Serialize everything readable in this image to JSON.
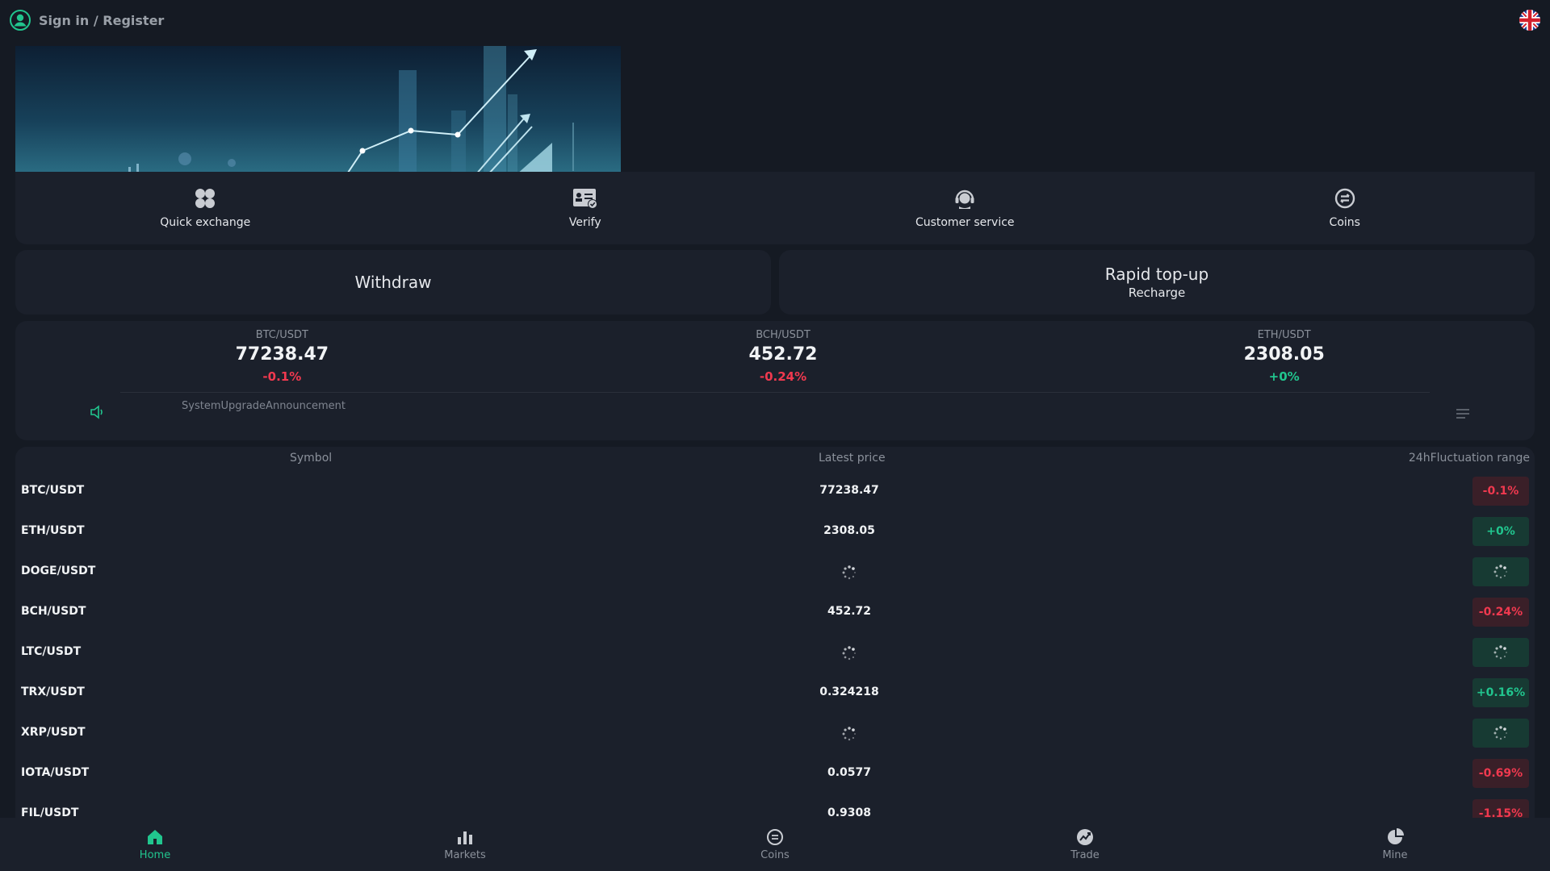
{
  "header": {
    "signin_label": "Sign in / Register",
    "language_flag": "uk-flag-icon"
  },
  "quick_actions": [
    {
      "label": "Quick exchange",
      "icon": "grid-icon"
    },
    {
      "label": "Verify",
      "icon": "id-card-icon"
    },
    {
      "label": "Customer service",
      "icon": "headset-icon"
    },
    {
      "label": "Coins",
      "icon": "coin-icon"
    }
  ],
  "cards": {
    "withdraw": "Withdraw",
    "rapid_topup": "Rapid top-up",
    "recharge": "Recharge"
  },
  "ticker": [
    {
      "pair": "BTC/USDT",
      "price": "77238.47",
      "change": "-0.1%",
      "trend": "down"
    },
    {
      "pair": "BCH/USDT",
      "price": "452.72",
      "change": "-0.24%",
      "trend": "down"
    },
    {
      "pair": "ETH/USDT",
      "price": "2308.05",
      "change": "+0%",
      "trend": "up"
    }
  ],
  "announcement": "SystemUpgradeAnnouncement",
  "market": {
    "headers": {
      "symbol": "Symbol",
      "latest_price": "Latest price",
      "range": "24hFluctuation range"
    },
    "rows": [
      {
        "symbol": "BTC/USDT",
        "price": "77238.47",
        "change": "-0.1%",
        "trend": "down"
      },
      {
        "symbol": "ETH/USDT",
        "price": "2308.05",
        "change": "+0%",
        "trend": "up"
      },
      {
        "symbol": "DOGE/USDT",
        "price": "",
        "change": "",
        "trend": "loading"
      },
      {
        "symbol": "BCH/USDT",
        "price": "452.72",
        "change": "-0.24%",
        "trend": "down"
      },
      {
        "symbol": "LTC/USDT",
        "price": "",
        "change": "",
        "trend": "loading"
      },
      {
        "symbol": "TRX/USDT",
        "price": "0.324218",
        "change": "+0.16%",
        "trend": "up"
      },
      {
        "symbol": "XRP/USDT",
        "price": "",
        "change": "",
        "trend": "loading"
      },
      {
        "symbol": "IOTA/USDT",
        "price": "0.0577",
        "change": "-0.69%",
        "trend": "down"
      },
      {
        "symbol": "FIL/USDT",
        "price": "0.9308",
        "change": "-1.15%",
        "trend": "down"
      }
    ]
  },
  "bottom_nav": [
    {
      "label": "Home",
      "icon": "home-icon",
      "active": true
    },
    {
      "label": "Markets",
      "icon": "bar-chart-icon",
      "active": false
    },
    {
      "label": "Coins",
      "icon": "coin-icon",
      "active": false
    },
    {
      "label": "Trade",
      "icon": "trade-icon",
      "active": false
    },
    {
      "label": "Mine",
      "icon": "pie-icon",
      "active": false
    }
  ],
  "colors": {
    "up": "#21c58e",
    "down": "#f0394f",
    "panel": "#1b202b",
    "background": "#151a23"
  }
}
